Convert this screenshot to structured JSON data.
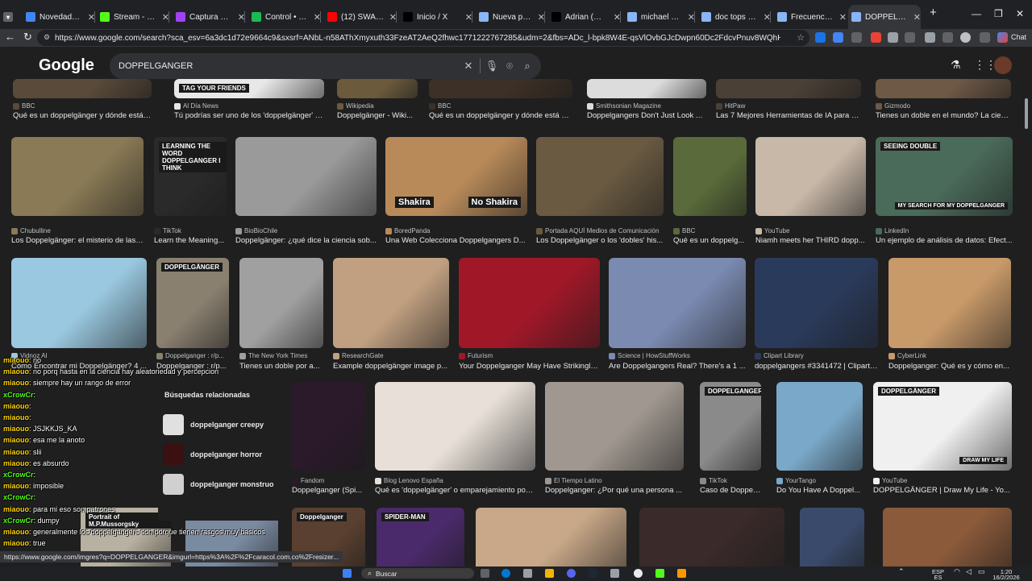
{
  "tabs": [
    {
      "label": "Novedades de M",
      "fav_color": "#4285f4"
    },
    {
      "label": "Stream - Kick Da",
      "fav_color": "#53fc18"
    },
    {
      "label": "Captura de pant",
      "fav_color": "#a142f4"
    },
    {
      "label": "Control • Playbo",
      "fav_color": "#1db954"
    },
    {
      "label": "(12) SWAGGERB",
      "fav_color": "#ff0000"
    },
    {
      "label": "Inicio / X",
      "fav_color": "#000000"
    },
    {
      "label": "Nueva pestaña",
      "fav_color": "#8ab4f8"
    },
    {
      "label": "Adrian (@adrian",
      "fav_color": "#000000"
    },
    {
      "label": "michael morales",
      "fav_color": "#8ab4f8"
    },
    {
      "label": "doc tops cara - B",
      "fav_color": "#8ab4f8"
    },
    {
      "label": "Frecuencia Tierra",
      "fav_color": "#8ab4f8"
    },
    {
      "label": "DOPPELGANGER",
      "fav_color": "#8ab4f8"
    }
  ],
  "address": {
    "url": "https://www.google.com/search?sca_esv=6a3dc1d72e9664c9&sxsrf=ANbL-n58AThXmyxuth33FzeAT2AeQ2fhwc1771222767285&udm=2&fbs=ADc_l-bpk8W4E-qsVlOvbGJcDwpn60Dc2FdcvPnuv8WQhHLTaMb_WtLz8zQ41bNqiqMK_0G...",
    "chat_label": "Chat"
  },
  "google": {
    "logo": "Google",
    "query": "DOPPELGANGER"
  },
  "row0": [
    {
      "source": "BBC",
      "caption": "Qué es un doppelgänger y dónde está el t...",
      "color": "#5a4a3a"
    },
    {
      "source": "Al Día News",
      "caption": "Tú podrías ser uno de los 'doppelgänger' qu...",
      "color": "#e8e8e8",
      "overlay": "TAG YOUR FRIENDS"
    },
    {
      "source": "Wikipedia",
      "caption": "Doppelgänger - Wiki...",
      "color": "#6b5a3c"
    },
    {
      "source": "BBC",
      "caption": "Qué es un doppelgänger y dónde está el t...",
      "color": "#3d3026"
    },
    {
      "source": "Smithsonian Magazine",
      "caption": "Doppelgangers Don't Just Look A...",
      "color": "#dcdcdc"
    },
    {
      "source": "HitPaw",
      "caption": "Las 7 Mejores Herramientas de IA para En...",
      "color": "#4a4036"
    },
    {
      "source": "Gizmodo",
      "caption": "Tienes un doble en el mundo? La cien...",
      "color": "#6e5846"
    }
  ],
  "row1": [
    {
      "source": "Chubulline",
      "caption": "Los Doppelgänger: el misterio de las ...",
      "color": "#8a7a55"
    },
    {
      "source": "TikTok",
      "caption": "Learn the Meaning...",
      "color": "#2a2a2a",
      "overlay": "LEARNING THE WORD DOPPELGANGER I THINK"
    },
    {
      "source": "BioBioChile",
      "caption": "Doppelgänger: ¿qué dice la ciencia sob...",
      "color": "#9a9a9a"
    },
    {
      "source": "BoredPanda",
      "caption": "Una Web Colecciona Doppelgangers D...",
      "color": "#b88a5a",
      "label_a": "Shakira",
      "label_b": "No Shakira"
    },
    {
      "source": "Portada AQUÍ Medios de Comunicación",
      "caption": "Los Doppelgänger o los 'dobles' his...",
      "color": "#6a5a42"
    },
    {
      "source": "BBC",
      "caption": "Qué es un doppelg...",
      "color": "#5a6a3a"
    },
    {
      "source": "YouTube",
      "caption": "Niamh meets her THIRD dopp...",
      "color": "#c8b8a8"
    },
    {
      "source": "LinkedIn",
      "caption": "Un ejemplo de análisis de datos: Efect...",
      "color": "#4a6a5a",
      "overlay": "SEEING DOUBLE",
      "overlay2": "MY SEARCH FOR MY DOPPELGANGER"
    }
  ],
  "row2": [
    {
      "source": "Vidnoz AI",
      "caption": "Cómo Encontrar mi Doppelgänger? 4 ...",
      "color": "#9ac8e0"
    },
    {
      "source": "Doppelganger : r/p...",
      "caption": "Doppelganger : r/p...",
      "color": "#8a8070",
      "overlay": "DOPPELGÄNGER"
    },
    {
      "source": "The New York Times",
      "caption": "Tienes un doble por a...",
      "color": "#a0a0a0"
    },
    {
      "source": "ResearchGate",
      "caption": "Example doppelgänger image p...",
      "color": "#c0a080"
    },
    {
      "source": "Futurism",
      "caption": "Your Doppelganger May Have Strikingly...",
      "color": "#a01828"
    },
    {
      "source": "Science | HowStuffWorks",
      "caption": "Are Doppelgangers Real? There's a 1 ...",
      "color": "#7a8ab0"
    },
    {
      "source": "Clipart Library",
      "caption": "doppelgangers #3341472 | Clipart ...",
      "color": "#2a3a5a"
    },
    {
      "source": "CyberLink",
      "caption": "Doppelganger: Qué es y cómo en...",
      "color": "#c89a6a"
    }
  ],
  "related": {
    "heading": "Búsquedas relacionadas",
    "items": [
      {
        "label": "doppelganger creepy",
        "color": "#e0e0e0"
      },
      {
        "label": "doppelganger horror",
        "color": "#3a1010"
      },
      {
        "label": "doppelganger monstruo",
        "color": "#d0d0d0"
      }
    ]
  },
  "row3": [
    {
      "source": "Fandom",
      "caption": "Doppelganger (Spi...",
      "color": "#2a1a2a"
    },
    {
      "source": "Blog Lenovo España",
      "caption": "Qué es 'doppelgänger' o emparejamiento por ...",
      "color": "#e8e0d8"
    },
    {
      "source": "El Tiempo Latino",
      "caption": "Doppelganger: ¿Por qué una persona ...",
      "color": "#a09890"
    },
    {
      "source": "TikTok",
      "caption": "Caso de Doppelgä...",
      "color": "#8a8a8a",
      "overlay": "DOPPELGANGER"
    },
    {
      "source": "YourTango",
      "caption": "Do You Have A Doppel...",
      "color": "#7aa8c8"
    },
    {
      "source": "YouTube",
      "caption": "DOPPELGÄNGER | Draw My Life - Yo...",
      "color": "#f0f0f0",
      "overlay": "DOPPELGÄNGER",
      "overlay2": "DRAW MY LIFE"
    }
  ],
  "row4": [
    {
      "color": "#b8b0a0",
      "overlay": "Portrait of M.P.Mussorgsky"
    },
    {
      "color": "#7a8aa0"
    },
    {
      "color": "#5a4030",
      "overlay": "Doppelganger"
    },
    {
      "color": "#4a2a6a",
      "overlay": "SPIDER-MAN"
    },
    {
      "color": "#c8a888"
    },
    {
      "color": "#3a2a2a"
    },
    {
      "color": "#3a4a6a"
    },
    {
      "color": "#8a5a3a"
    }
  ],
  "chat": [
    {
      "nick": "miaouo",
      "text": "no",
      "color": "#ffd700"
    },
    {
      "nick": "miaouo",
      "text": "no porq hasta en la ciencia hay aleatoriedad y percepcion",
      "color": "#ffd700"
    },
    {
      "nick": "miaouo",
      "text": "siempre hay un rango de error",
      "color": "#ffd700"
    },
    {
      "nick": "xCrowCr",
      "text": "",
      "color": "#53fc18"
    },
    {
      "nick": "miaouo",
      "text": "",
      "color": "#ffd700"
    },
    {
      "nick": "miaouo",
      "text": "",
      "color": "#ffd700"
    },
    {
      "nick": "miaouo",
      "text": "JSJKKJS_KA",
      "color": "#ffd700"
    },
    {
      "nick": "miaouo",
      "text": "esa me la anoto",
      "color": "#ffd700"
    },
    {
      "nick": "miaouo",
      "text": "slii",
      "color": "#ffd700"
    },
    {
      "nick": "miaouo",
      "text": "es absurdo",
      "color": "#ffd700"
    },
    {
      "nick": "xCrowCr",
      "text": "",
      "color": "#53fc18"
    },
    {
      "nick": "miaouo",
      "text": "imposible",
      "color": "#ffd700"
    },
    {
      "nick": "xCrowCr",
      "text": "",
      "color": "#53fc18"
    },
    {
      "nick": "miaouo",
      "text": "para mi eso son patrones",
      "color": "#ffd700"
    },
    {
      "nick": "xCrowCr",
      "text": "dumpy",
      "color": "#53fc18"
    },
    {
      "nick": "miaouo",
      "text": "generalmente los doppelgangers son porque tienen rasgos muy basicos",
      "color": "#ffd700"
    },
    {
      "nick": "miaouo",
      "text": "true",
      "color": "#ffd700"
    }
  ],
  "statusbar": {
    "url": "https://www.google.com/imgres?q=DOPPELGANGER&imgurl=https%3A%2F%2Fcaracol.com.co%2Fresizer..."
  },
  "taskbar": {
    "search_label": "Buscar",
    "lang_line1": "ESP",
    "lang_line2": "ES",
    "time": "1:20",
    "date": "16/2/2026"
  }
}
